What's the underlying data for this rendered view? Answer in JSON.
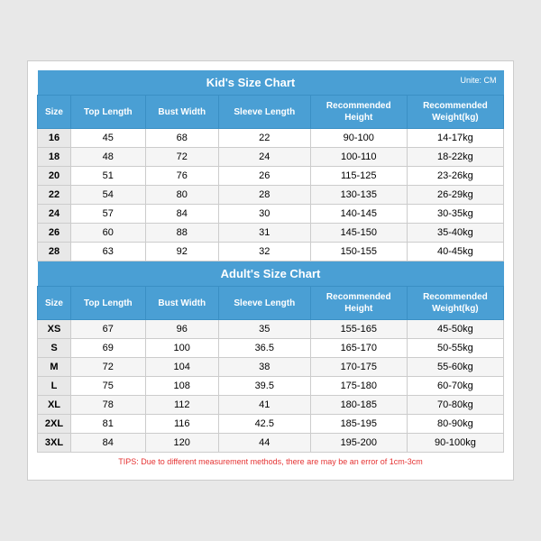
{
  "kids_chart": {
    "title": "Kid's Size Chart",
    "unit": "Unite: CM",
    "headers": [
      "Size",
      "Top Length",
      "Bust Width",
      "Sleeve Length",
      "Recommended\nHeight",
      "Recommended\nWeight(kg)"
    ],
    "rows": [
      [
        "16",
        "45",
        "68",
        "22",
        "90-100",
        "14-17kg"
      ],
      [
        "18",
        "48",
        "72",
        "24",
        "100-110",
        "18-22kg"
      ],
      [
        "20",
        "51",
        "76",
        "26",
        "115-125",
        "23-26kg"
      ],
      [
        "22",
        "54",
        "80",
        "28",
        "130-135",
        "26-29kg"
      ],
      [
        "24",
        "57",
        "84",
        "30",
        "140-145",
        "30-35kg"
      ],
      [
        "26",
        "60",
        "88",
        "31",
        "145-150",
        "35-40kg"
      ],
      [
        "28",
        "63",
        "92",
        "32",
        "150-155",
        "40-45kg"
      ]
    ]
  },
  "adults_chart": {
    "title": "Adult's Size Chart",
    "headers": [
      "Size",
      "Top Length",
      "Bust Width",
      "Sleeve Length",
      "Recommended\nHeight",
      "Recommended\nWeight(kg)"
    ],
    "rows": [
      [
        "XS",
        "67",
        "96",
        "35",
        "155-165",
        "45-50kg"
      ],
      [
        "S",
        "69",
        "100",
        "36.5",
        "165-170",
        "50-55kg"
      ],
      [
        "M",
        "72",
        "104",
        "38",
        "170-175",
        "55-60kg"
      ],
      [
        "L",
        "75",
        "108",
        "39.5",
        "175-180",
        "60-70kg"
      ],
      [
        "XL",
        "78",
        "112",
        "41",
        "180-185",
        "70-80kg"
      ],
      [
        "2XL",
        "81",
        "116",
        "42.5",
        "185-195",
        "80-90kg"
      ],
      [
        "3XL",
        "84",
        "120",
        "44",
        "195-200",
        "90-100kg"
      ]
    ]
  },
  "tips": "TIPS: Due to different measurement methods, there are may be an error of 1cm-3cm"
}
